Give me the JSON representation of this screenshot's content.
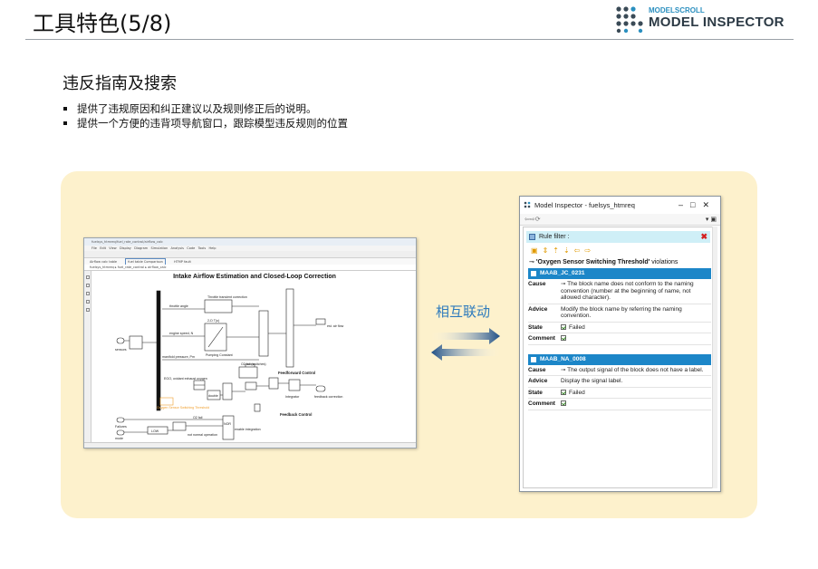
{
  "slide": {
    "title": "工具特色(5/8)",
    "section_heading": "违反指南及搜索",
    "bullets": [
      "提供了违规原因和纠正建议以及规则修正后的说明。",
      "提供一个方便的违背项导航窗口，跟踪模型违反规则的位置"
    ],
    "link_label": "相互联动"
  },
  "logo": {
    "small_text": "MODELSCROLL",
    "big_text": "MODEL INSPECTOR",
    "accent_color": "#2a8fbf"
  },
  "simulink": {
    "diagram_title": "Intake Airflow Estimation and Closed-Loop Correction",
    "block_labels": {
      "throttle_estimate": "Throttle transient correction",
      "throttle_angle": "throttle angle",
      "engine_speed": "engine speed, N",
      "pumping_constant": "Pumping Constant",
      "manifold_pressure": "manifold pressure, Pm",
      "feedforward": "Feedforward Control",
      "ego": "EGO, oxidant exhaust oxygen",
      "o2_switch": "Oxygen Sensor Switching Threshold",
      "feedback": "Feedback Control",
      "integrator": "Integrator",
      "sensors": "sensors",
      "failures": "Failures",
      "mode": "mode",
      "est_air_flow": "est. air flow",
      "feedback_correction": "feedback correction",
      "low": "LOW",
      "not_normal": "not normal operation",
      "enable_integration": "enable integration",
      "nor": "NOR",
      "double": "double",
      "o2_fail": "O2 fail",
      "cond_o2": "O2 fail (switches)",
      "lookup": "2-D T(u)"
    }
  },
  "inspector": {
    "window_title": "Model Inspector - fuelsys_htmreq",
    "rule_filter_label": "Rule filter :",
    "violation_heading": "'Oxygen Sensor Switching Threshold'",
    "violation_suffix": "violations",
    "violations": [
      {
        "id": "MAAB_JC_0231",
        "cause_label": "Cause",
        "cause": "The block name does not conform to the naming convention (number at the beginning of name, not allowed character).",
        "advice_label": "Advice",
        "advice": "Modify the block name by referring the naming convention.",
        "state_label": "State",
        "state": "Failed",
        "comment_label": "Comment"
      },
      {
        "id": "MAAB_NA_0008",
        "cause_label": "Cause",
        "cause": "The output signal of the block does not have a label.",
        "advice_label": "Advice",
        "advice": "Display the signal label.",
        "state_label": "State",
        "state": "Failed",
        "comment_label": "Comment"
      }
    ]
  }
}
